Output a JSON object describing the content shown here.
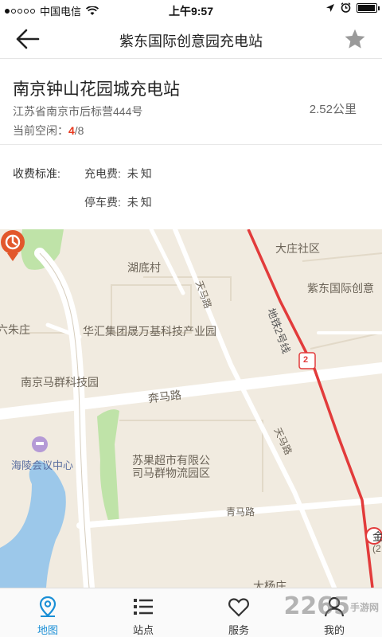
{
  "status_bar": {
    "carrier": "中国电信",
    "time": "上午9:57",
    "battery_level": 0.95
  },
  "navbar": {
    "title": "紫东国际创意园充电站",
    "back_icon": "back-arrow-icon",
    "favorite_icon": "star-icon"
  },
  "station": {
    "name": "南京钟山花园城充电站",
    "address": "江苏省南京市后标营444号",
    "availability_label": "当前空闲：",
    "available": "4",
    "total": "/8",
    "distance": "2.52公里"
  },
  "fees": {
    "title": "收费标准:",
    "charge_label": "充电费:",
    "charge_value": "未知",
    "parking_label": "停车费:",
    "parking_value": "未知"
  },
  "map": {
    "labels": [
      "大庄社区",
      "湖底村",
      "天马路",
      "紫东国际创意",
      "地铁2号线",
      "六朱庄",
      "华汇集团晟万基科技产业园",
      "南京马群科技园",
      "奔马路",
      "天马路",
      "海陵会议中心",
      "苏果超市有限公",
      "司马群物流园区",
      "青马路",
      "大杨庄",
      "金",
      "(2",
      "2"
    ],
    "colors": {
      "background": "#f1ebe0",
      "road": "#ffffff",
      "metro": "#e23b3b",
      "green": "#bfe3a8",
      "water": "#9cc8ea",
      "pin": "#e2572b"
    }
  },
  "tabs": [
    {
      "label": "地图",
      "icon": "map-pin-icon",
      "active": true
    },
    {
      "label": "站点",
      "icon": "list-icon",
      "active": false
    },
    {
      "label": "服务",
      "icon": "heart-icon",
      "active": false
    },
    {
      "label": "我的",
      "icon": "user-icon",
      "active": false
    }
  ],
  "watermark": {
    "text": "2265",
    "sub": "手游网"
  }
}
